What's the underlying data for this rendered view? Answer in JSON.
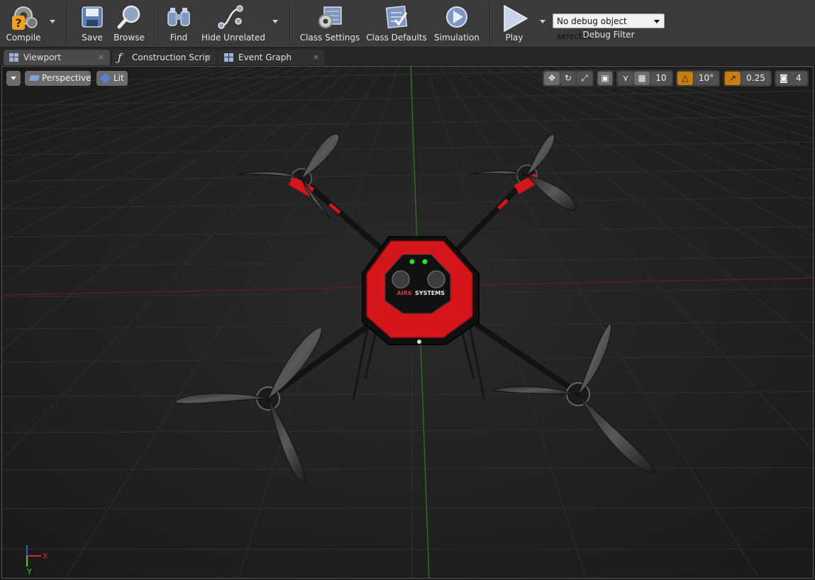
{
  "toolbar": {
    "compile": "Compile",
    "save": "Save",
    "browse": "Browse",
    "find": "Find",
    "hide_unrelated": "Hide Unrelated",
    "class_settings": "Class Settings",
    "class_defaults": "Class Defaults",
    "simulation": "Simulation",
    "play": "Play",
    "debug_select": "No debug object selected",
    "debug_filter": "Debug Filter"
  },
  "tabs": [
    {
      "label": "Viewport",
      "icon": "viewport-icon",
      "close": "×"
    },
    {
      "label": "Construction Scrip",
      "icon": "function-icon",
      "close": "×"
    },
    {
      "label": "Event Graph",
      "icon": "graph-icon",
      "close": "×"
    }
  ],
  "viewport": {
    "view_mode": "Perspective",
    "lighting": "Lit",
    "grid_snap": "10",
    "rotation_snap": "10°",
    "scale_snap": "0.25",
    "camera_speed": "4",
    "drone_logo_left": "AIR6",
    "drone_logo_right": "SYSTEMS",
    "axis_x": "X",
    "axis_y": "Y",
    "colors": {
      "accent_orange": "#c97d10",
      "drone_red": "#d4151b",
      "grid_green": "#2e7d2e",
      "grid_red": "#7a2020"
    }
  }
}
